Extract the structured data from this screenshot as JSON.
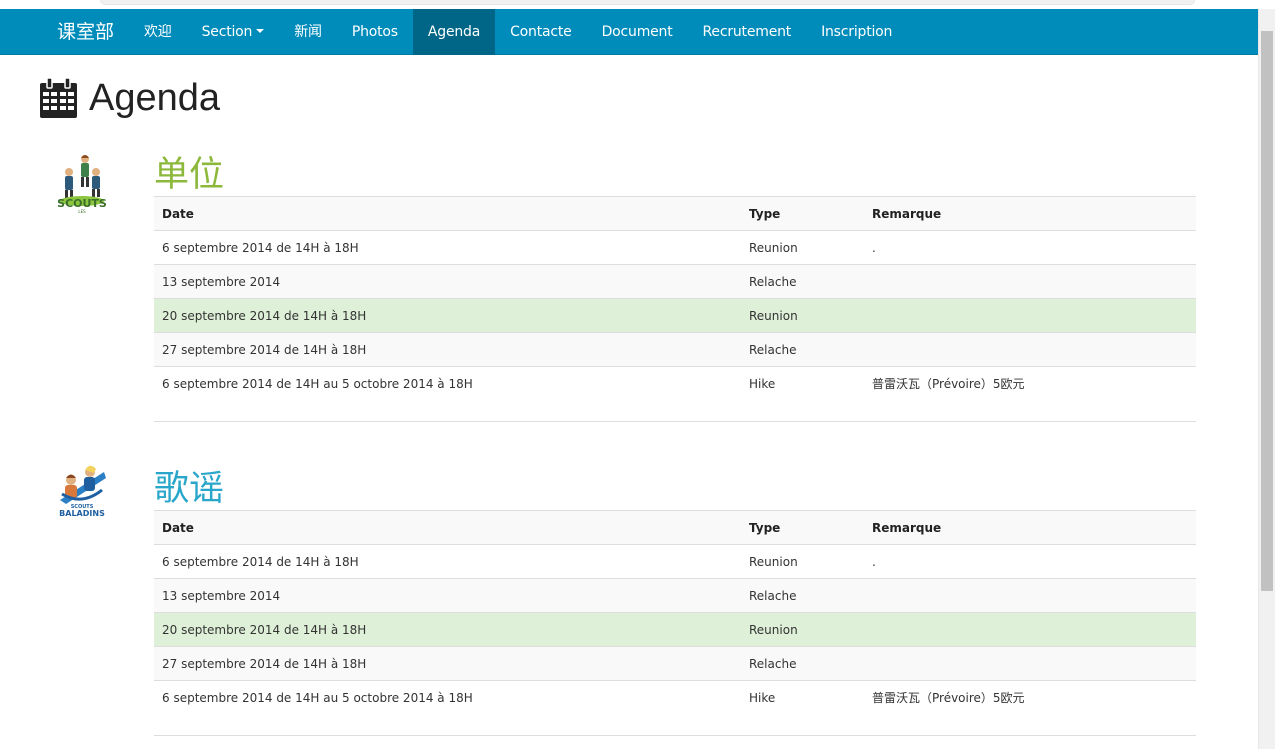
{
  "nav": {
    "brand": "课室部",
    "items": [
      {
        "label": "欢迎",
        "active": false,
        "dropdown": false
      },
      {
        "label": "Section",
        "active": false,
        "dropdown": true
      },
      {
        "label": "新闻",
        "active": false,
        "dropdown": false
      },
      {
        "label": "Photos",
        "active": false,
        "dropdown": false
      },
      {
        "label": "Agenda",
        "active": true,
        "dropdown": false
      },
      {
        "label": "Contacte",
        "active": false,
        "dropdown": false
      },
      {
        "label": "Document",
        "active": false,
        "dropdown": false
      },
      {
        "label": "Recrutement",
        "active": false,
        "dropdown": false
      },
      {
        "label": "Inscription",
        "active": false,
        "dropdown": false
      }
    ]
  },
  "page": {
    "title": "Agenda",
    "title_icon": "calendar-icon"
  },
  "colors": {
    "navbar": "#008cba",
    "nav_active": "#006687",
    "section1_heading": "#8cb83c",
    "section2_heading": "#2ba6cb",
    "success_row": "#dff0d8"
  },
  "sections": [
    {
      "heading": "单位",
      "logo": "scouts-logo",
      "columns": [
        "Date",
        "Type",
        "Remarque"
      ],
      "rows": [
        {
          "date": "6 septembre 2014 de 14H à 18H",
          "type": "Reunion",
          "remark": ".",
          "style": "odd"
        },
        {
          "date": "13 septembre 2014",
          "type": "Relache",
          "remark": "",
          "style": "even"
        },
        {
          "date": "20 septembre 2014 de 14H à 18H",
          "type": "Reunion",
          "remark": "",
          "style": "success"
        },
        {
          "date": "27 septembre 2014 de 14H à 18H",
          "type": "Relache",
          "remark": "",
          "style": "even"
        },
        {
          "date": "6 septembre 2014 de 14H au 5 octobre 2014 à 18H",
          "type": "Hike",
          "remark": "普雷沃瓦（Prévoire）5欧元",
          "style": "odd"
        }
      ]
    },
    {
      "heading": "歌谣",
      "logo": "baladins-logo",
      "columns": [
        "Date",
        "Type",
        "Remarque"
      ],
      "rows": [
        {
          "date": "6 septembre 2014 de 14H à 18H",
          "type": "Reunion",
          "remark": ".",
          "style": "odd"
        },
        {
          "date": "13 septembre 2014",
          "type": "Relache",
          "remark": "",
          "style": "even"
        },
        {
          "date": "20 septembre 2014 de 14H à 18H",
          "type": "Reunion",
          "remark": "",
          "style": "success"
        },
        {
          "date": "27 septembre 2014 de 14H à 18H",
          "type": "Relache",
          "remark": "",
          "style": "even"
        },
        {
          "date": "6 septembre 2014 de 14H au 5 octobre 2014 à 18H",
          "type": "Hike",
          "remark": "普雷沃瓦（Prévoire）5欧元",
          "style": "odd"
        }
      ]
    }
  ]
}
